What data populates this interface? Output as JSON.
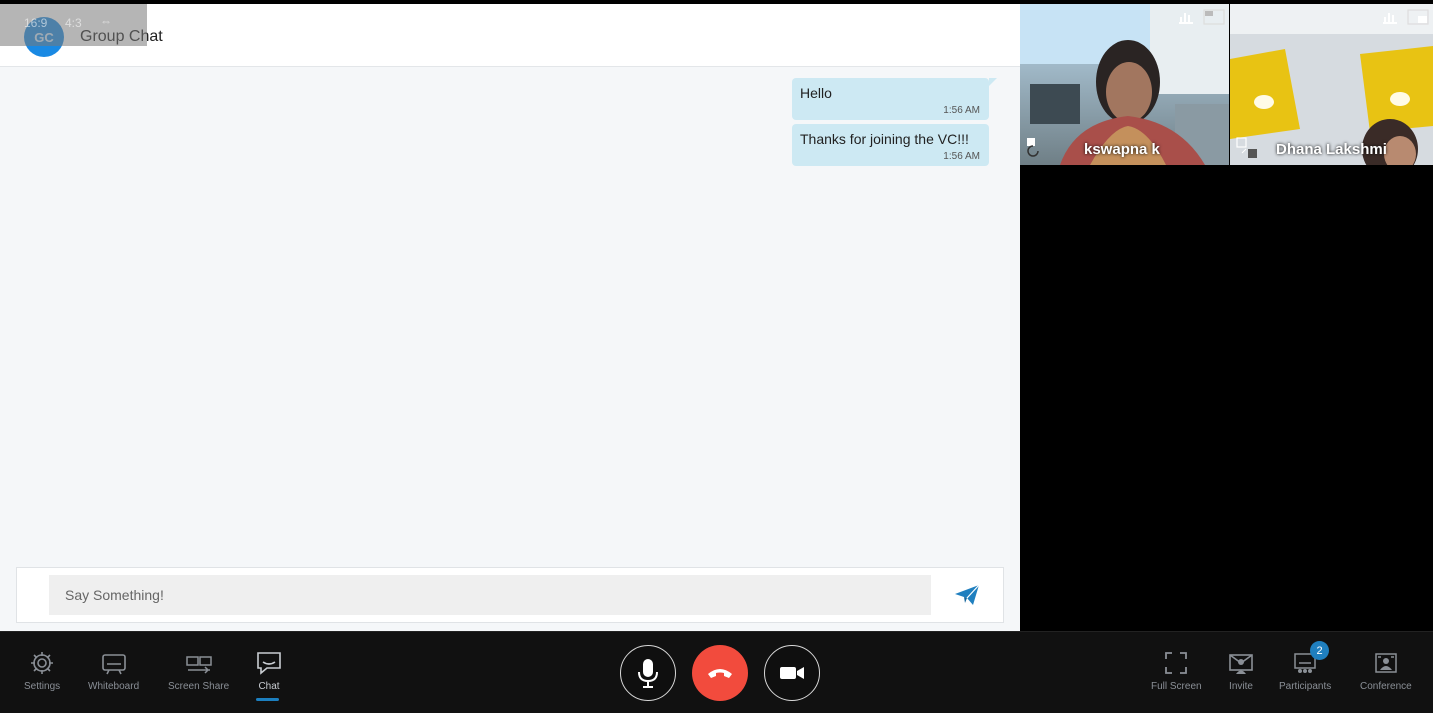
{
  "chat": {
    "avatar_initials": "GC",
    "title": "Group Chat",
    "aspect_options": [
      "16:9",
      "4:3"
    ],
    "messages": [
      {
        "text": "Hello",
        "time": "1:56 AM"
      },
      {
        "text": "Thanks for joining the VC!!!",
        "time": "1:56 AM"
      }
    ],
    "input_placeholder": "Say Something!",
    "send_icon": "send-icon"
  },
  "participants": [
    {
      "name": "kswapna k"
    },
    {
      "name": "Dhana Lakshmi"
    }
  ],
  "toolbar": {
    "left": [
      {
        "label": "Settings",
        "icon": "gear-icon"
      },
      {
        "label": "Whiteboard",
        "icon": "whiteboard-icon"
      },
      {
        "label": "Screen Share",
        "icon": "screen-share-icon"
      },
      {
        "label": "Chat",
        "icon": "chat-icon"
      }
    ],
    "right": [
      {
        "label": "Full Screen",
        "icon": "fullscreen-icon"
      },
      {
        "label": "Invite",
        "icon": "invite-icon"
      },
      {
        "label": "Participants",
        "icon": "participants-icon"
      },
      {
        "label": "Conference",
        "icon": "conference-icon"
      }
    ],
    "participants_count": "2"
  },
  "colors": {
    "accent": "#1f7fbf",
    "end_call": "#f24b3d",
    "bubble": "#cde9f3",
    "avatar": "#1989e3"
  }
}
